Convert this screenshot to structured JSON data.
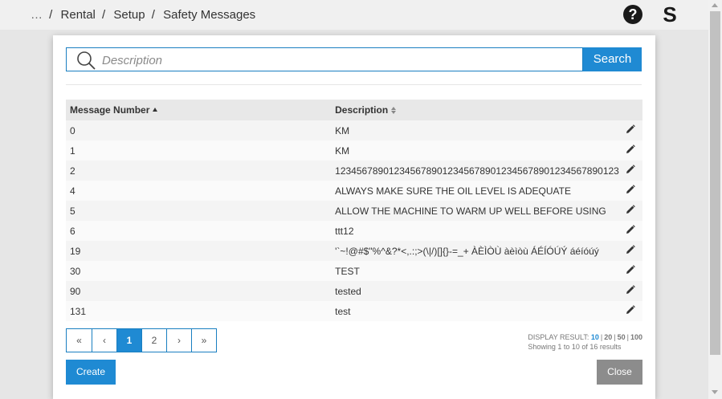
{
  "breadcrumb": {
    "ellipsis": "…",
    "items": [
      "Rental",
      "Setup",
      "Safety Messages"
    ],
    "separator": "/"
  },
  "header": {
    "help_glyph": "?",
    "app_glyph": "S"
  },
  "search": {
    "placeholder": "Description",
    "value": "",
    "button_label": "Search"
  },
  "table": {
    "columns": [
      "Message Number",
      "Description"
    ],
    "rows": [
      {
        "number": "0",
        "description": "KM"
      },
      {
        "number": "1",
        "description": "KM"
      },
      {
        "number": "2",
        "description": "12345678901234567890123456789012345678901234567890123"
      },
      {
        "number": "4",
        "description": "ALWAYS MAKE SURE THE OIL LEVEL IS ADEQUATE"
      },
      {
        "number": "5",
        "description": "ALLOW THE MACHINE TO WARM UP WELL BEFORE USING"
      },
      {
        "number": "6",
        "description": "ttt12"
      },
      {
        "number": "19",
        "description": "'`~!@#$\"%^&?*<,.:;>(\\|/)[]{}-=_+ ÀÈÌÒÙ àèìòù ÁÉÍÓÚÝ áéíóúý"
      },
      {
        "number": "30",
        "description": "TEST"
      },
      {
        "number": "90",
        "description": "tested"
      },
      {
        "number": "131",
        "description": "test"
      }
    ]
  },
  "pagination": {
    "first": "«",
    "prev": "‹",
    "pages": [
      "1",
      "2"
    ],
    "current": "1",
    "next": "›",
    "last": "»"
  },
  "display_result": {
    "label": "DISPLAY RESULT:",
    "sizes": [
      "10",
      "20",
      "50",
      "100"
    ],
    "selected": "10",
    "summary": "Showing 1 to 10 of 16 results"
  },
  "footer": {
    "create_label": "Create",
    "close_label": "Close"
  },
  "colors": {
    "accent": "#1f8ad3",
    "close_button": "#8c8c8c",
    "header_row": "#e8e8e8"
  },
  "icons": {
    "search": "search-icon",
    "help": "help-icon",
    "app": "app-s-icon",
    "edit": "pencil-icon",
    "sort_asc": "sort-asc-icon",
    "sort_both": "sort-icon"
  }
}
